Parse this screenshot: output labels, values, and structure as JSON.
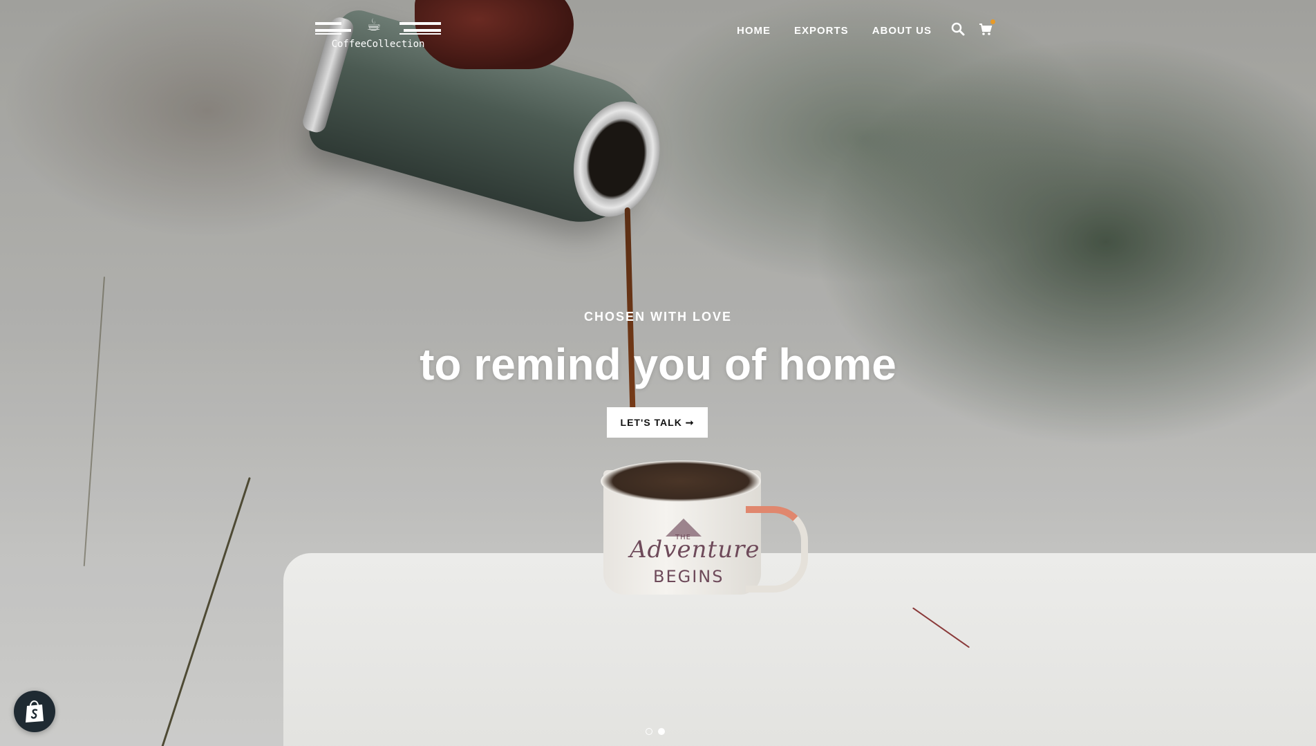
{
  "brand": {
    "logo_text": "CoffeeCollection",
    "logo_cup": "☕"
  },
  "nav": {
    "items": [
      {
        "label": "HOME"
      },
      {
        "label": "EXPORTS"
      },
      {
        "label": "ABOUT US"
      }
    ]
  },
  "icons": {
    "search": "search-icon",
    "cart": "cart-icon",
    "shopify": "shopify-bag-icon"
  },
  "hero": {
    "eyebrow": "CHOSEN WITH LOVE",
    "headline": "to remind you of home",
    "cta_label": "LET'S TALK ➞",
    "mug_text_the": "THE",
    "mug_text_adventure": "Adventure",
    "mug_text_begins": "BEGINS"
  },
  "slider": {
    "slide_count": 2,
    "active_slide": 2
  },
  "colors": {
    "cart_badge": "#e79a28",
    "shopify_badge_bg": "#1f2a32",
    "cta_bg": "#ffffff"
  }
}
